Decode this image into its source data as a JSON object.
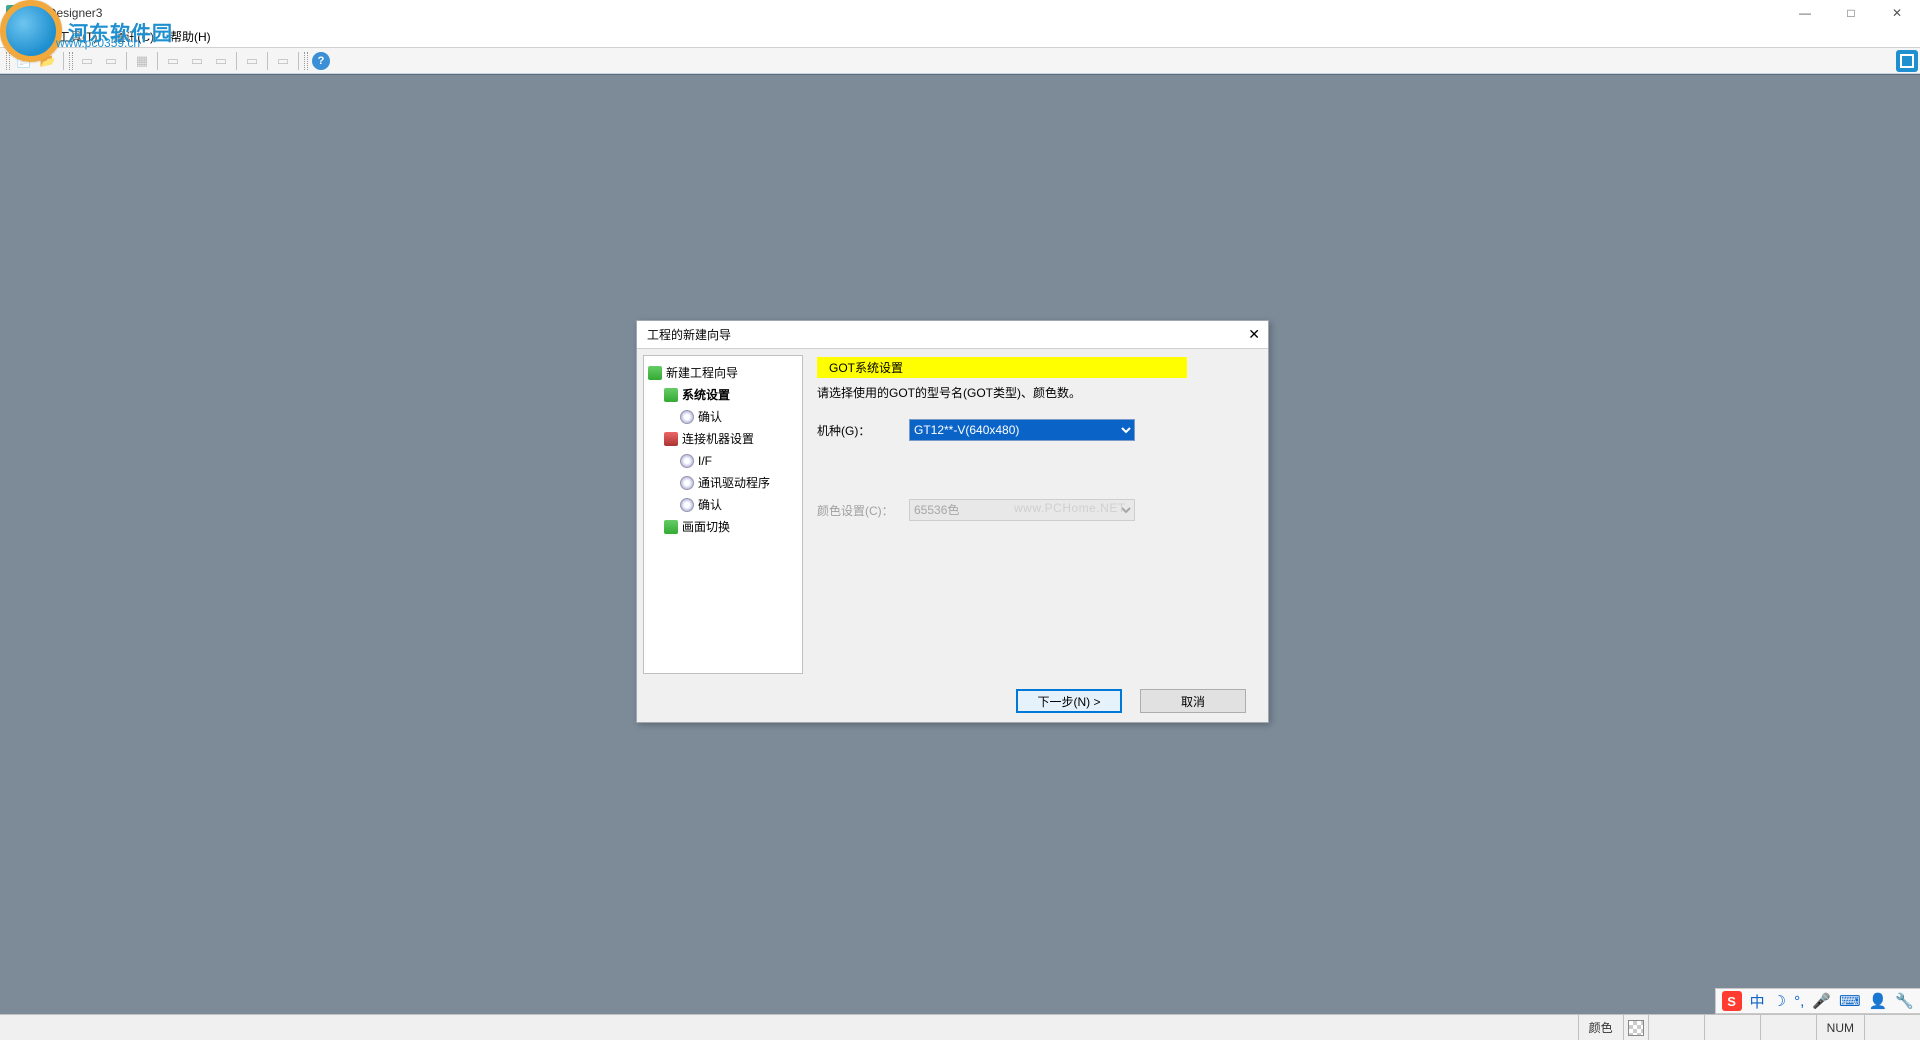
{
  "window": {
    "title": "GT Designer3"
  },
  "watermark": {
    "brand": "河东软件园",
    "url": "www.pc0359.cn",
    "panel_text": "www.PCHome.NET"
  },
  "menu": {
    "items": [
      "工具(T)",
      "通讯(C)",
      "帮助(H)"
    ]
  },
  "dialog": {
    "title": "工程的新建向导",
    "section_header": "GOT系统设置",
    "description": "请选择使用的GOT的型号名(GOT类型)、颜色数。",
    "fields": {
      "model_label": "机种(G)：",
      "model_value": "GT12**-V(640x480)",
      "color_label": "颜色设置(C)：",
      "color_value": "65536色"
    },
    "tree": {
      "root": "新建工程向导",
      "n1": "系统设置",
      "n1a": "确认",
      "n2": "连接机器设置",
      "n2a": "I/F",
      "n2b": "通讯驱动程序",
      "n2c": "确认",
      "n3": "画面切换"
    },
    "buttons": {
      "next": "下一步(N) >",
      "cancel": "取消"
    }
  },
  "statusbar": {
    "color_label": "颜色",
    "num": "NUM"
  },
  "ime": {
    "lang": "中"
  }
}
